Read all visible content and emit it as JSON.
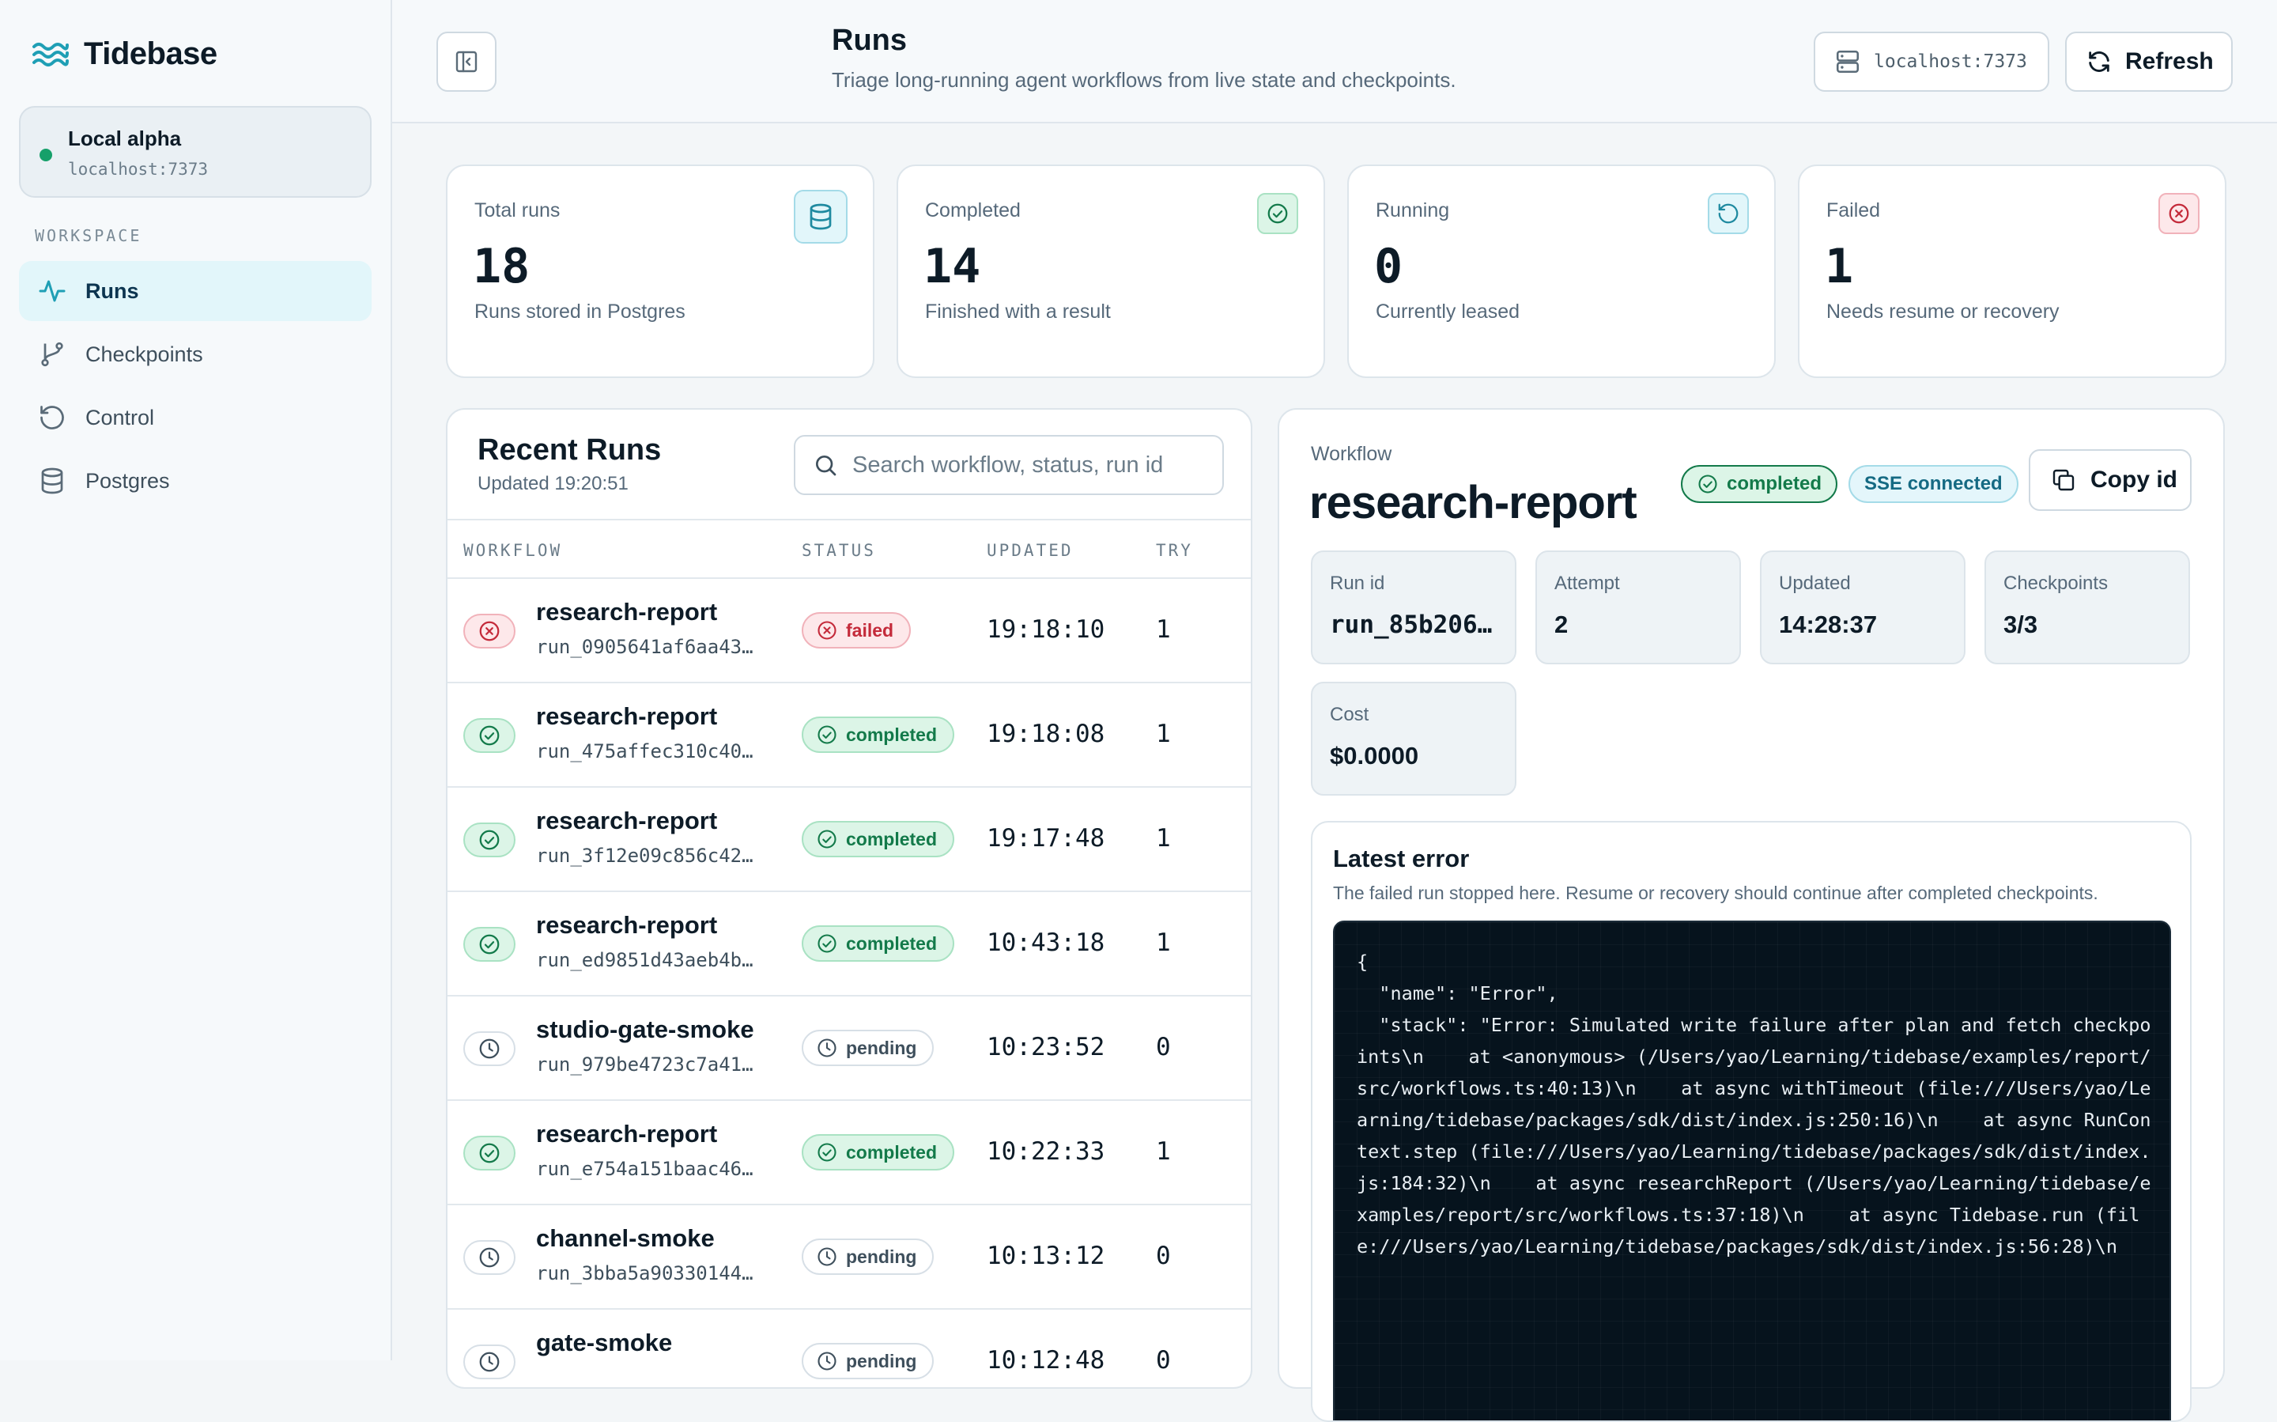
{
  "brand": {
    "name": "Tidebase"
  },
  "environment": {
    "name": "Local alpha",
    "host": "localhost:7373",
    "status_color": "#16a06a"
  },
  "sidebar": {
    "section": "WORKSPACE",
    "items": [
      {
        "label": "Runs",
        "icon": "activity-icon",
        "active": true
      },
      {
        "label": "Checkpoints",
        "icon": "git-branch-icon",
        "active": false
      },
      {
        "label": "Control",
        "icon": "rotate-ccw-icon",
        "active": false
      },
      {
        "label": "Postgres",
        "icon": "database-icon",
        "active": false
      }
    ]
  },
  "header": {
    "title": "Runs",
    "subtitle": "Triage long-running agent workflows from live state and checkpoints.",
    "host": "localhost:7373",
    "refresh_label": "Refresh"
  },
  "stats": [
    {
      "label": "Total runs",
      "value": "18",
      "desc": "Runs stored in Postgres",
      "icon": "database-icon",
      "color": "#2a9bb0"
    },
    {
      "label": "Completed",
      "value": "14",
      "desc": "Finished with a result",
      "icon": "check-circle-icon",
      "color": "#16a06a"
    },
    {
      "label": "Running",
      "value": "0",
      "desc": "Currently leased",
      "icon": "rotate-ccw-icon",
      "color": "#2a9bb0"
    },
    {
      "label": "Failed",
      "value": "1",
      "desc": "Needs resume or recovery",
      "icon": "x-circle-icon",
      "color": "#d23a4a"
    }
  ],
  "runs": {
    "title": "Recent Runs",
    "updated": "Updated 19:20:51",
    "search_placeholder": "Search workflow, status, run id",
    "columns": [
      "WORKFLOW",
      "STATUS",
      "UPDATED",
      "TRY"
    ],
    "rows": [
      {
        "workflow": "research-report",
        "run_id": "run_0905641af6aa43…",
        "status": "failed",
        "updated": "19:18:10",
        "try": "1"
      },
      {
        "workflow": "research-report",
        "run_id": "run_475affec310c40…",
        "status": "completed",
        "updated": "19:18:08",
        "try": "1"
      },
      {
        "workflow": "research-report",
        "run_id": "run_3f12e09c856c42…",
        "status": "completed",
        "updated": "19:17:48",
        "try": "1"
      },
      {
        "workflow": "research-report",
        "run_id": "run_ed9851d43aeb4b…",
        "status": "completed",
        "updated": "10:43:18",
        "try": "1"
      },
      {
        "workflow": "studio-gate-smoke",
        "run_id": "run_979be4723c7a41…",
        "status": "pending",
        "updated": "10:23:52",
        "try": "0"
      },
      {
        "workflow": "research-report",
        "run_id": "run_e754a151baac46…",
        "status": "completed",
        "updated": "10:22:33",
        "try": "1"
      },
      {
        "workflow": "channel-smoke",
        "run_id": "run_3bba5a90330144…",
        "status": "pending",
        "updated": "10:13:12",
        "try": "0"
      },
      {
        "workflow": "gate-smoke",
        "run_id": "",
        "status": "pending",
        "updated": "10:12:48",
        "try": "0"
      }
    ]
  },
  "detail": {
    "label": "Workflow",
    "title": "research-report",
    "status": "completed",
    "sse": "SSE connected",
    "copy_label": "Copy id",
    "metrics": [
      {
        "label": "Run id",
        "value": "run_85b206…"
      },
      {
        "label": "Attempt",
        "value": "2"
      },
      {
        "label": "Updated",
        "value": "14:28:37"
      },
      {
        "label": "Checkpoints",
        "value": "3/3"
      },
      {
        "label": "Cost",
        "value": "$0.0000"
      }
    ],
    "error": {
      "title": "Latest error",
      "subtitle": "The failed run stopped here. Resume or recovery should continue after completed checkpoints.",
      "code": "{\n  \"name\": \"Error\",\n  \"stack\": \"Error: Simulated write failure after plan and fetch checkpoints\\n    at <anonymous> (/Users/yao/Learning/tidebase/examples/report/src/workflows.ts:40:13)\\n    at async withTimeout (file:///Users/yao/Learning/tidebase/packages/sdk/dist/index.js:250:16)\\n    at async RunContext.step (file:///Users/yao/Learning/tidebase/packages/sdk/dist/index.js:184:32)\\n    at async researchReport (/Users/yao/Learning/tidebase/examples/report/src/workflows.ts:37:18)\\n    at async Tidebase.run (file:///Users/yao/Learning/tidebase/packages/sdk/dist/index.js:56:28)\\n"
    }
  },
  "colors": {
    "accent": "#2a9bb0",
    "success": "#16a06a",
    "danger": "#d23a4a"
  }
}
